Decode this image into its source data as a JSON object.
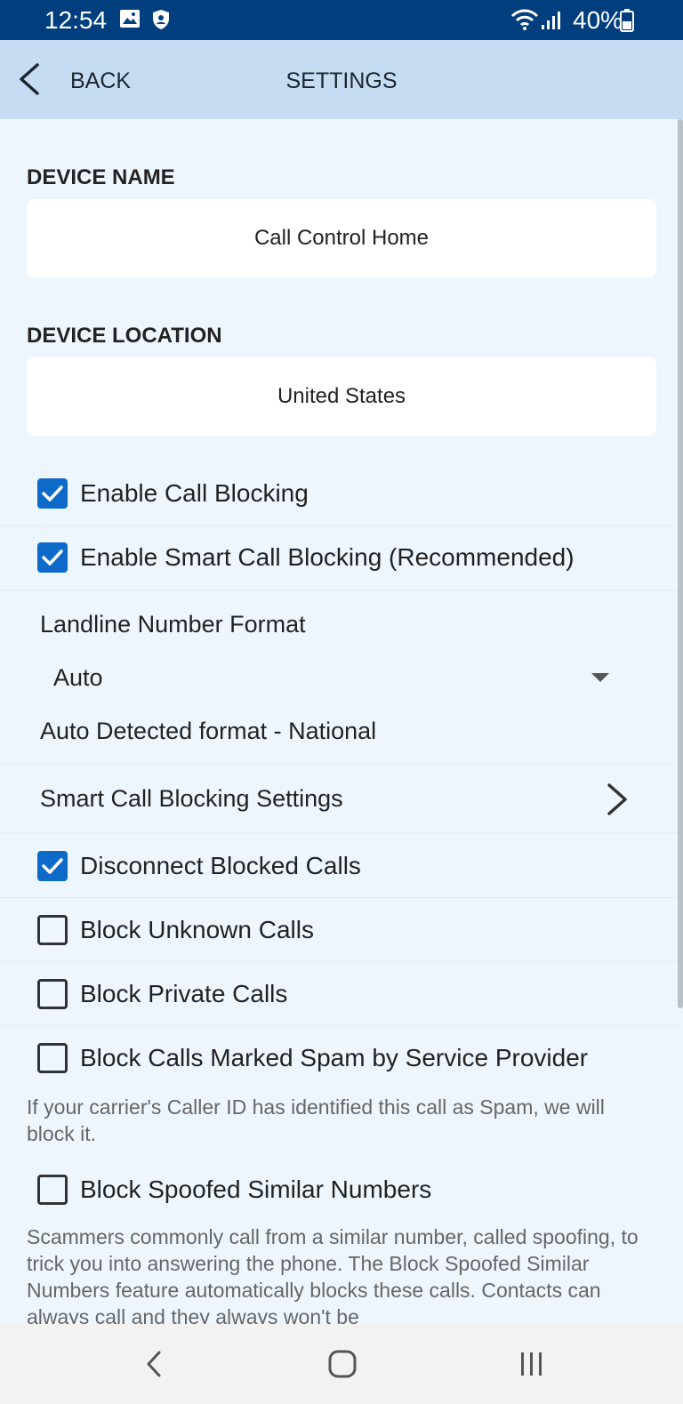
{
  "status_bar": {
    "time": "12:54",
    "battery_percent": "40%",
    "icons": [
      "image-icon",
      "shield-icon",
      "wifi-icon",
      "signal-icon",
      "battery-icon"
    ]
  },
  "header": {
    "back_label": "BACK",
    "title": "SETTINGS"
  },
  "device_name": {
    "label": "DEVICE NAME",
    "value": "Call Control Home"
  },
  "device_location": {
    "label": "DEVICE LOCATION",
    "value": "United States"
  },
  "toggles": {
    "enable_call_blocking": {
      "label": "Enable Call Blocking",
      "checked": true
    },
    "enable_smart_call_blocking": {
      "label": "Enable Smart Call Blocking (Recommended)",
      "checked": true
    },
    "disconnect_blocked_calls": {
      "label": "Disconnect Blocked Calls",
      "checked": true
    },
    "block_unknown_calls": {
      "label": "Block Unknown Calls",
      "checked": false
    },
    "block_private_calls": {
      "label": "Block Private Calls",
      "checked": false
    },
    "block_spam_calls": {
      "label": "Block Calls Marked Spam by Service Provider",
      "checked": false
    },
    "block_spoofed_numbers": {
      "label": "Block Spoofed Similar Numbers",
      "checked": false
    }
  },
  "landline_format": {
    "label": "Landline Number Format",
    "selected": "Auto",
    "detected": "Auto Detected format - National"
  },
  "smart_settings": {
    "label": "Smart Call Blocking Settings"
  },
  "descriptions": {
    "spam": "If your carrier's Caller ID has identified this call as Spam, we will block it.",
    "spoofed": "Scammers commonly call from a similar number, called spoofing, to trick you into answering the phone. The Block Spoofed Similar Numbers feature automatically blocks these calls. Contacts can always call and they always won't be"
  },
  "colors": {
    "status_bar": "#003e7e",
    "header": "#c5dcf3",
    "background": "#eef6fd",
    "checkbox_checked": "#0d6ac9"
  }
}
